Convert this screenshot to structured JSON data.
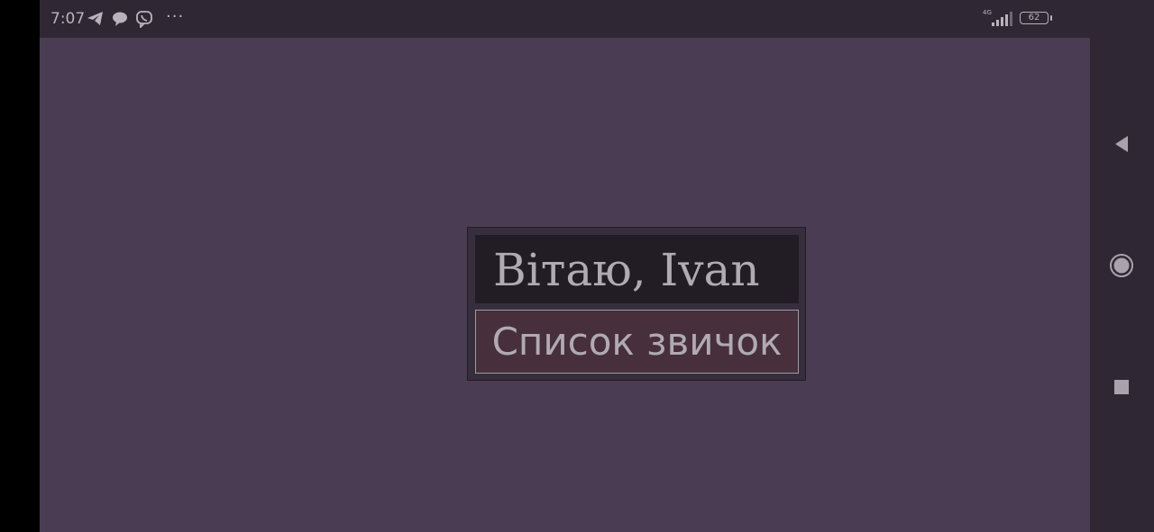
{
  "status_bar": {
    "time": "7:07",
    "notification_icons": [
      "telegram-icon",
      "chat-bubble-icon",
      "viber-icon"
    ],
    "more_indicator": "···",
    "network_type": "4G",
    "battery_level": "62"
  },
  "navigation_bar": {
    "buttons": [
      "back",
      "home",
      "recents"
    ]
  },
  "main": {
    "greeting": "Вітаю, Ivan",
    "habits_button_label": "Список звичок"
  },
  "colors": {
    "app_background": "#4a3d53",
    "system_bars": "#2f2834",
    "greeting_background": "#221c25",
    "button_background": "#47303b",
    "text": "#b0aab3"
  }
}
